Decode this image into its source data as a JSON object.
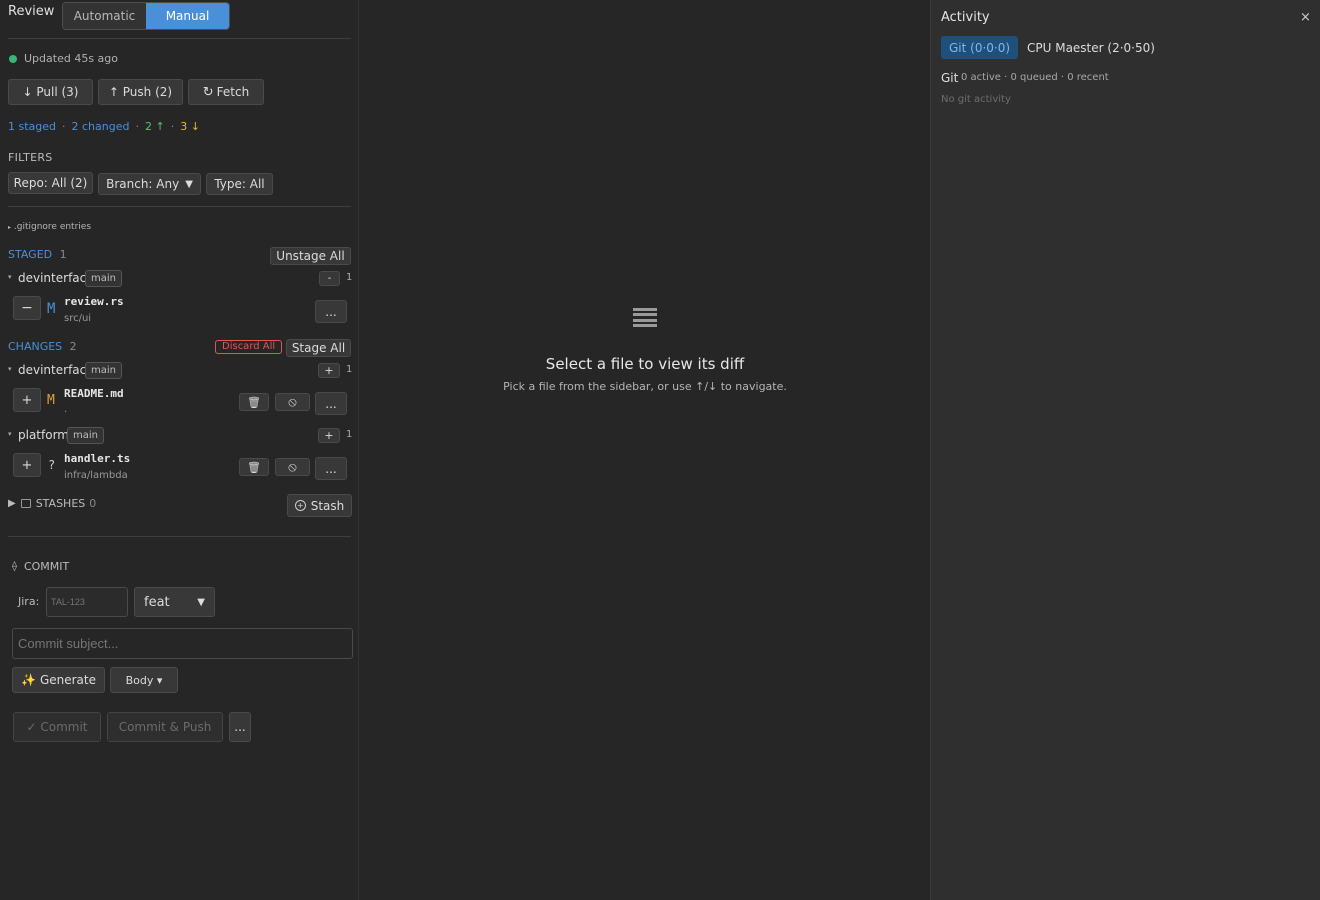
{
  "review": {
    "title": "Review",
    "mode_automatic": "Automatic",
    "mode_manual": "Manual",
    "status": "Updated 45s ago",
    "pull": "↓ Pull (3)",
    "push": "↑ Push (2)",
    "fetch": "Fetch",
    "summary": {
      "staged": "1 staged",
      "changed": "2 changed",
      "ahead": "2 ↑",
      "behind": "3 ↓",
      "sep": "·"
    },
    "filters_label": "FILTERS",
    "filter_repo": "Repo: All (2)",
    "filter_branch": "Branch: Any",
    "filter_type": "Type: All",
    "gitignore": ".gitignore entries"
  },
  "staged": {
    "label": "STAGED",
    "count": "1",
    "unstage_all": "Unstage All",
    "repo": {
      "name": "devinterface",
      "branch": "main",
      "toggle": "-",
      "count": "1"
    },
    "files": [
      {
        "action": "−",
        "status": "M",
        "name": "review.rs",
        "path": "src/ui",
        "more": "..."
      }
    ]
  },
  "changes": {
    "label": "CHANGES",
    "count": "2",
    "discard_all": "Discard All",
    "stage_all": "Stage All",
    "repos": [
      {
        "name": "devinterface",
        "branch": "main",
        "toggle": "+",
        "count": "1",
        "file": {
          "action": "+",
          "status": "M",
          "name": "README.md",
          "path": ".",
          "more": "..."
        }
      },
      {
        "name": "platform",
        "branch": "main",
        "toggle": "+",
        "count": "1",
        "file": {
          "action": "+",
          "status": "?",
          "name": "handler.ts",
          "path": "infra/lambda",
          "more": "..."
        }
      }
    ]
  },
  "stashes": {
    "label": "STASHES",
    "count": "0",
    "stash_button": "Stash"
  },
  "commit": {
    "label": "COMMIT",
    "jira_label": "Jira:",
    "jira_placeholder": "TAL-123",
    "type_value": "feat",
    "subject_placeholder": "Commit subject...",
    "generate": "Generate",
    "body": "Body ▾",
    "commit": "✓ Commit",
    "commit_push": "Commit & Push",
    "more": "..."
  },
  "diff": {
    "title": "Select a file to view its diff",
    "hint": "Pick a file from the sidebar, or use ↑/↓ to navigate."
  },
  "activity": {
    "title": "Activity",
    "close": "×",
    "tabs": [
      "Git (0·0·0)",
      "CPU Maester (2·0·50)"
    ],
    "git_label": "Git",
    "git_stats": "0 active · 0 queued · 0 recent",
    "empty": "No git activity"
  },
  "colors": {
    "accent": "#4a90d9",
    "status_ok": "#3cb371",
    "modified_staged": "#4a90d9",
    "modified_unstaged": "#e2a03f",
    "ahead": "#5fbf6a",
    "behind": "#e0b83a",
    "danger": "#e05555"
  }
}
